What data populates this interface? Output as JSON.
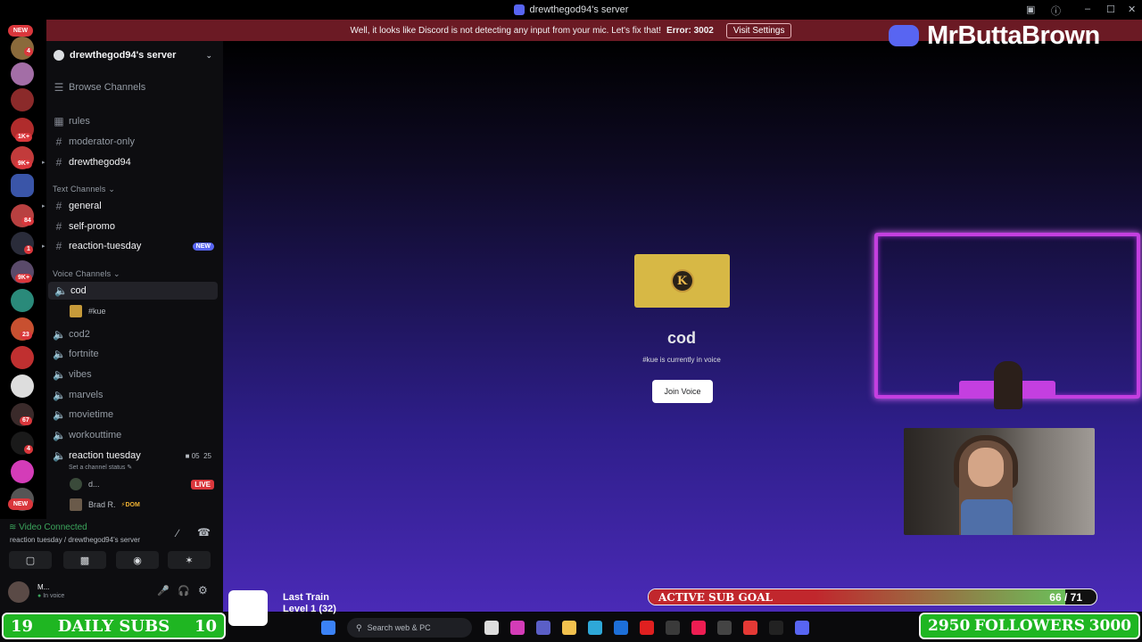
{
  "window": {
    "title": "drewthegod94's server"
  },
  "notice": {
    "message": "Well, it looks like Discord is not detecting any input from your mic. Let's fix that!",
    "error": "Error: 3002",
    "button": "Visit Settings"
  },
  "rail": {
    "top_badge": "NEW",
    "bottom_badge": "NEW",
    "badges": [
      "4",
      "1K+",
      "9K+",
      "84",
      "1",
      "9K+",
      "23",
      "67",
      "4"
    ]
  },
  "sidebar": {
    "server_name": "drewthegod94's server",
    "browse": "Browse Channels",
    "top_channels": [
      "rules",
      "moderator-only",
      "drewthegod94"
    ],
    "text_category": "Text Channels",
    "text_channels": [
      "general",
      "self-promo",
      "reaction-tuesday"
    ],
    "new_badge": "NEW",
    "voice_category": "Voice Channels",
    "voice_channels": [
      "cod",
      "cod2",
      "fortnite",
      "vibes",
      "marvels",
      "movietime",
      "workouttime",
      "reaction tuesday"
    ],
    "cod_user": "#kue",
    "reaction_meta_1": "05",
    "reaction_meta_2": "25",
    "reaction_status": "Set a channel status",
    "reaction_users": [
      {
        "name": "d...",
        "badge": "LIVE"
      },
      {
        "name": "Brad R.",
        "tag": "DOM"
      }
    ]
  },
  "voice_panel": {
    "status": "Video Connected",
    "location": "reaction tuesday / drewthegod94's server",
    "user_name": "M...",
    "user_status": "In voice"
  },
  "stage": {
    "channel": "cod",
    "subtitle": "#kue is currently in voice",
    "join_button": "Join Voice",
    "card_letter": "K"
  },
  "overlay": {
    "logo_text": "MrButtaBrown",
    "sub_goal_label": "ACTIVE SUB GOAL",
    "sub_goal_current": 66,
    "sub_goal_target": 71,
    "sub_goal_text": "66 / 71",
    "daily_subs_left": "19",
    "daily_subs_label": "DAILY SUBS",
    "daily_subs_right": "10",
    "followers_left": "2950",
    "followers_label": "FOLLOWERS",
    "followers_right": "3000",
    "music_title": "Last Train",
    "music_level": "Level 1 (32)"
  },
  "taskbar": {
    "search_placeholder": "Search web & PC"
  }
}
